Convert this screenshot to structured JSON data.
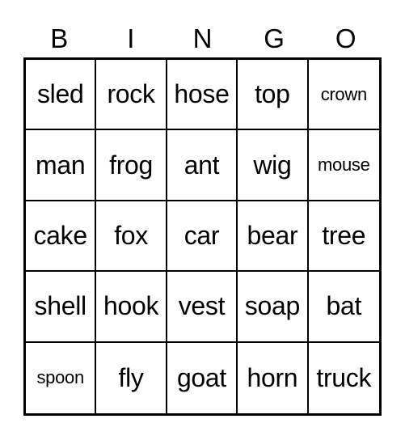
{
  "header": {
    "letters": [
      "B",
      "I",
      "N",
      "G",
      "O"
    ]
  },
  "card": {
    "rows": [
      [
        {
          "word": "sled"
        },
        {
          "word": "rock"
        },
        {
          "word": "hose"
        },
        {
          "word": "top"
        },
        {
          "word": "crown",
          "small": true
        }
      ],
      [
        {
          "word": "man"
        },
        {
          "word": "frog"
        },
        {
          "word": "ant"
        },
        {
          "word": "wig"
        },
        {
          "word": "mouse",
          "small": true
        }
      ],
      [
        {
          "word": "cake"
        },
        {
          "word": "fox"
        },
        {
          "word": "car"
        },
        {
          "word": "bear"
        },
        {
          "word": "tree"
        }
      ],
      [
        {
          "word": "shell"
        },
        {
          "word": "hook"
        },
        {
          "word": "vest"
        },
        {
          "word": "soap"
        },
        {
          "word": "bat"
        }
      ],
      [
        {
          "word": "spoon",
          "small": true
        },
        {
          "word": "fly"
        },
        {
          "word": "goat"
        },
        {
          "word": "horn"
        },
        {
          "word": "truck"
        }
      ]
    ]
  }
}
